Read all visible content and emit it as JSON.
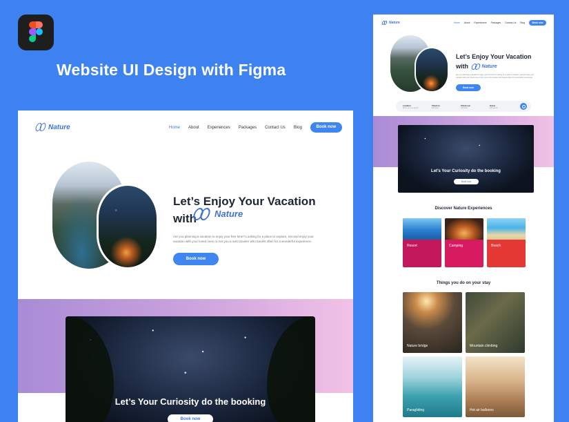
{
  "headline": "Website UI Design with Figma",
  "brand": {
    "logo_text": "Nature",
    "accent": "#3f86f0",
    "background": "#3d82f0"
  },
  "nav": {
    "items": [
      "Home",
      "About",
      "Experiences",
      "Packages",
      "Contact Us",
      "Blog"
    ],
    "cta": "Book now"
  },
  "hero": {
    "title_line1": "Let’s Enjoy Your Vacation",
    "title_line2": "with",
    "description": "Are you planning a vacation to enjoy your free time? Looking for a place to explore, eat and enjoy your vacation with your loved ones or Are you a solo traveler who travels often for a wonderful experience.",
    "button": "Book now"
  },
  "search": {
    "fields": [
      {
        "label": "Location",
        "value": "Where are you going?"
      },
      {
        "label": "Check in",
        "value": "Add dates"
      },
      {
        "label": "Check out",
        "value": "Add dates"
      },
      {
        "label": "Guest",
        "value": "Add guests"
      }
    ]
  },
  "banner": {
    "caption": "Let’s Your Curiosity do the booking",
    "button": "Book now"
  },
  "experiences": {
    "title": "Discover Nature Experiences",
    "cards": [
      {
        "label": "Resort",
        "color": "#c2185b"
      },
      {
        "label": "Camping",
        "color": "#d81b60"
      },
      {
        "label": "Beach",
        "color": "#e53935"
      }
    ]
  },
  "activities": {
    "title": "Things you do on your stay",
    "tiles": [
      "Nature bridge",
      "Mountain climbing",
      "Paragliding",
      "Hot air balloons"
    ]
  }
}
